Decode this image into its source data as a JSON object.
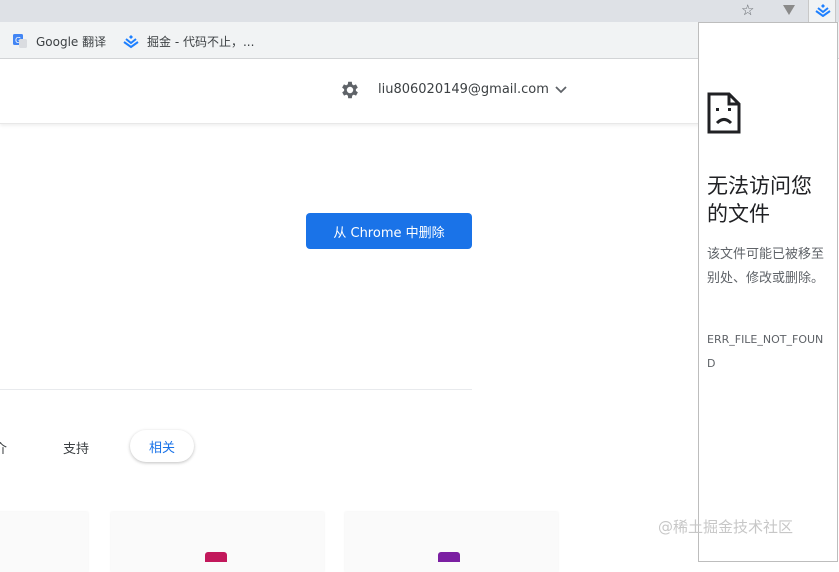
{
  "browser": {
    "bookmarks": [
      {
        "label": "Google 翻译",
        "icon": "google-translate-icon"
      },
      {
        "label": "掘金 - 代码不止，...",
        "icon": "juejin-icon"
      }
    ],
    "toolbar_icons": [
      "star-icon",
      "v-extension-icon",
      "juejin-extension-icon"
    ]
  },
  "header": {
    "account_email": "liu806020149@gmail.com",
    "settings_icon": "gear-icon"
  },
  "main": {
    "remove_button_label": "从 Chrome 中删除",
    "tabs": [
      {
        "label": "介",
        "selected": false
      },
      {
        "label": "支持",
        "selected": false
      },
      {
        "label": "相关",
        "selected": true
      }
    ]
  },
  "error_popup": {
    "title": "无法访问您的文件",
    "message": "该文件可能已被移至别处、修改或删除。",
    "code": "ERR_FILE_NOT_FOUND"
  },
  "watermark": "@稀土掘金技术社区",
  "colors": {
    "accent": "#1a73e8",
    "chrome_bg": "#dee1e6",
    "bookmarks_bg": "#f1f3f4"
  }
}
